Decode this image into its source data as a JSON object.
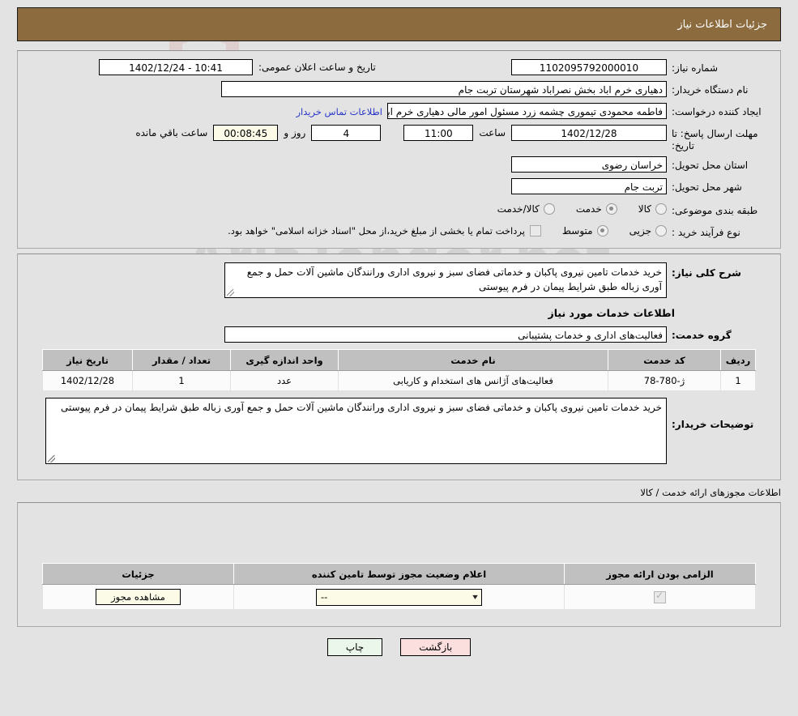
{
  "header": {
    "title": "جزئیات اطلاعات نیاز"
  },
  "main": {
    "need_number_label": "شماره نیاز:",
    "need_number_value": "1102095792000010",
    "announce_label": "تاریخ و ساعت اعلان عمومی:",
    "announce_value": "1402/12/24 - 10:41",
    "buyer_org_label": "نام دستگاه خریدار:",
    "buyer_org_value": "دهیاری خرم اباد بخش نصراباد شهرستان تربت جام",
    "requester_label": "ایجاد کننده درخواست:",
    "requester_value": "فاطمه محمودی تیموری چشمه زرد مسئول امور مالی دهیاری خرم اباد بخش نص",
    "contact_link": "اطلاعات تماس خریدار",
    "deadline_label": "مهلت ارسال پاسخ: تا تاریخ:",
    "deadline_date": "1402/12/28",
    "hour_label": "ساعت",
    "deadline_time": "11:00",
    "days_value": "4",
    "days_label": "روز و",
    "countdown_value": "00:08:45",
    "countdown_label": "ساعت باقي مانده",
    "province_label": "استان محل تحویل:",
    "province_value": "خراسان رضوی",
    "city_label": "شهر محل تحویل:",
    "city_value": "تربت جام",
    "category_label": "طبقه بندی موضوعی:",
    "category_options": [
      {
        "label": "کالا",
        "checked": false
      },
      {
        "label": "خدمت",
        "checked": true
      },
      {
        "label": "کالا/خدمت",
        "checked": false
      }
    ],
    "process_label": "نوع فرآیند خرید :",
    "process_options": [
      {
        "label": "جزیی",
        "checked": false
      },
      {
        "label": "متوسط",
        "checked": true
      }
    ],
    "process_note": "پرداخت تمام یا بخشی از مبلغ خرید،از محل \"اسناد خزانه اسلامی\" خواهد بود."
  },
  "description": {
    "general_label": "شرح کلی نیاز:",
    "general_value": "خرید خدمات تامین نیروی پاکبان و خدماتی فضای سبز و نیروی اداری ورانندگان ماشین آلات حمل و جمع آوری زباله طبق شرایط پیمان در فرم پیوستی",
    "section_title": "اطلاعات خدمات مورد نیاز",
    "service_group_label": "گروه خدمت:",
    "service_group_value": "فعالیت‌های اداری و خدمات پشتیبانی",
    "buyer_notes_label": "توضیحات خریدار:",
    "buyer_notes_value": "خرید خدمات تامین نیروی پاکبان و خدماتی فضای سبز و نیروی اداری ورانندگان ماشین آلات حمل و جمع آوری زباله طبق شرایط پیمان در فرم پیوستی"
  },
  "services_table": {
    "columns": [
      "ردیف",
      "کد خدمت",
      "نام خدمت",
      "واحد اندازه گیری",
      "تعداد / مقدار",
      "تاریخ نیاز"
    ],
    "rows": [
      {
        "row_no": "1",
        "code": "ژ-780-78",
        "name": "فعالیت‌های آژانس های استخدام و کاریابی",
        "unit": "عدد",
        "qty": "1",
        "need_date": "1402/12/28"
      }
    ]
  },
  "permits": {
    "section_title": "اطلاعات مجوزهای ارائه خدمت / کالا",
    "columns": [
      "الزامی بودن ارائه مجوز",
      "اعلام وضعیت مجوز توسط تامین کننده",
      "جزئیات"
    ],
    "rows": [
      {
        "required_checked": true,
        "status_value": "--",
        "details_button": "مشاهده مجوز"
      }
    ]
  },
  "footer": {
    "print_label": "چاپ",
    "back_label": "بازگشت"
  },
  "watermark": {
    "text": "AriaTender.net"
  },
  "colors": {
    "header_bg": "#8c6b3e",
    "page_bg": "#e3e3e3",
    "link": "#2a36c8",
    "table_header": "#c0c0c0",
    "yellow_field": "#fbfbe8"
  }
}
